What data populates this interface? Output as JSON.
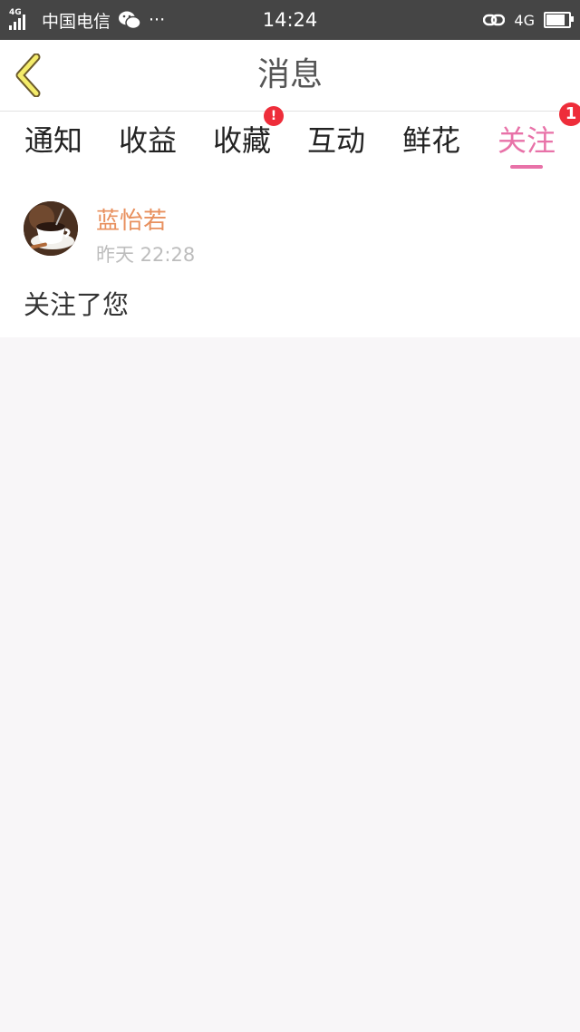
{
  "status_bar": {
    "network_tag": "4G",
    "carrier": "中国电信",
    "more": "···",
    "time": "14:24",
    "network_right": "4G",
    "icons": [
      "signal-icon",
      "wechat-icon",
      "link-icon",
      "battery-charging-icon"
    ]
  },
  "header": {
    "title": "消息",
    "back_icon": "chevron-left-icon"
  },
  "tabs": [
    {
      "label": "通知"
    },
    {
      "label": "收益"
    },
    {
      "label": "收藏",
      "badge": "!"
    },
    {
      "label": "互动"
    },
    {
      "label": "鲜花"
    },
    {
      "label": "关注",
      "badge": "1",
      "active": true
    }
  ],
  "message": {
    "name": "蓝怡若",
    "time": "昨天 22:28",
    "text": "关注了您",
    "avatar": "coffee-cup-avatar"
  },
  "colors": {
    "status_bar_bg": "#454545",
    "accent": "#e872a8",
    "name_color": "#e8905e",
    "badge": "#ee2d3a",
    "back_icon_fill": "#f4ec6a"
  }
}
